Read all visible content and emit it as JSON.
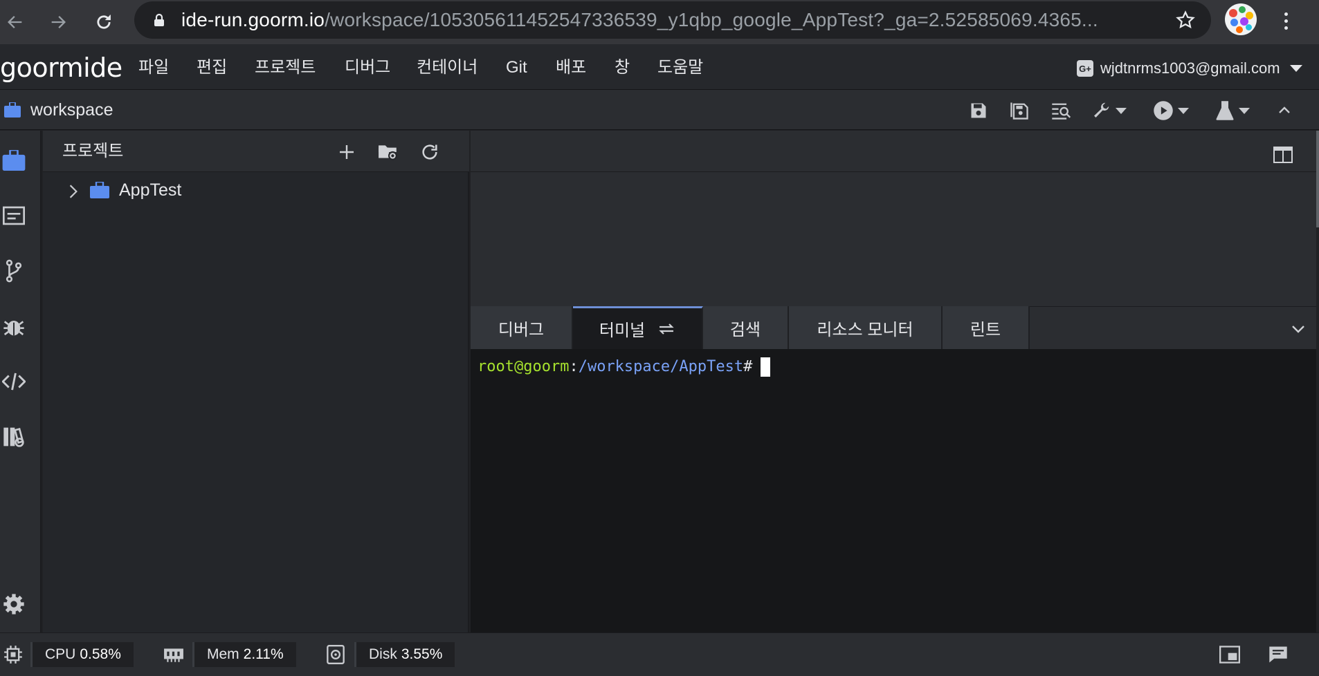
{
  "browser": {
    "url_host": "ide-run.goorm.io",
    "url_path": "/workspace/10530561145254733653​9_y1qbp_google_AppTest?_ga=2.52585069.4365..."
  },
  "menubar": {
    "logo": "goormide",
    "items": [
      "파일",
      "편집",
      "프로젝트",
      "디버그",
      "컨테이너",
      "Git",
      "배포",
      "창",
      "도움말"
    ],
    "account_email": "wjdtnrms1003@gmail.com",
    "account_badge": "G+"
  },
  "workspace": {
    "title": "workspace"
  },
  "project_panel": {
    "title": "프로젝트",
    "tree": [
      {
        "label": "AppTest",
        "expanded": false
      }
    ]
  },
  "bottom_panel": {
    "tabs": [
      "디버그",
      "터미널",
      "검색",
      "리소스 모니터",
      "린트"
    ],
    "active_tab": "터미널"
  },
  "terminal": {
    "user": "root@goorm",
    "separator": ":",
    "path": "/workspace/AppTest",
    "prompt": "#"
  },
  "status": {
    "cpu_label": "CPU",
    "cpu_value": "0.58%",
    "mem_label": "Mem",
    "mem_value": "2.11%",
    "disk_label": "Disk",
    "disk_value": "3.55%"
  },
  "colors": {
    "accent_tab": "#6e8fd6",
    "folder": "#5b8def",
    "terminal_user": "#a6e22e",
    "terminal_path": "#7aa2f7"
  },
  "icons": {
    "toolbar": [
      "save-icon",
      "save-all-icon",
      "find-in-files-icon",
      "wrench-icon",
      "run-icon",
      "flask-icon",
      "collapse-up-icon"
    ],
    "activity": [
      "project-explorer-icon",
      "outline-icon",
      "git-branch-icon",
      "debug-bug-icon",
      "code-icon",
      "library-icon",
      "settings-gear-icon"
    ]
  }
}
